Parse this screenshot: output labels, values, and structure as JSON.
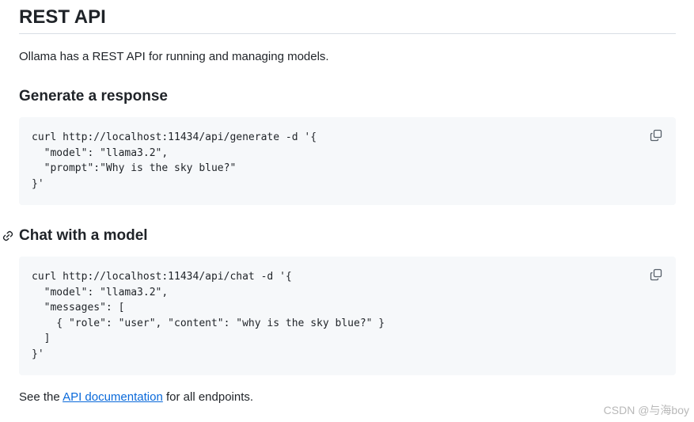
{
  "page": {
    "title": "REST API",
    "intro": "Ollama has a REST API for running and managing models."
  },
  "sections": [
    {
      "heading": "Generate a response",
      "code": "curl http://localhost:11434/api/generate -d '{\n  \"model\": \"llama3.2\",\n  \"prompt\":\"Why is the sky blue?\"\n}'"
    },
    {
      "heading": "Chat with a model",
      "code": "curl http://localhost:11434/api/chat -d '{\n  \"model\": \"llama3.2\",\n  \"messages\": [\n    { \"role\": \"user\", \"content\": \"why is the sky blue?\" }\n  ]\n}'"
    }
  ],
  "footer": {
    "prefix": "See the ",
    "link_label": "API documentation",
    "suffix": " for all endpoints."
  },
  "watermark": "CSDN @与海boy",
  "icons": {
    "copy": "copy-icon",
    "anchor": "link-icon"
  },
  "colors": {
    "link": "#0969da",
    "code_background": "#f6f8fa",
    "text": "#1f2328",
    "rule": "#d8dee4"
  }
}
